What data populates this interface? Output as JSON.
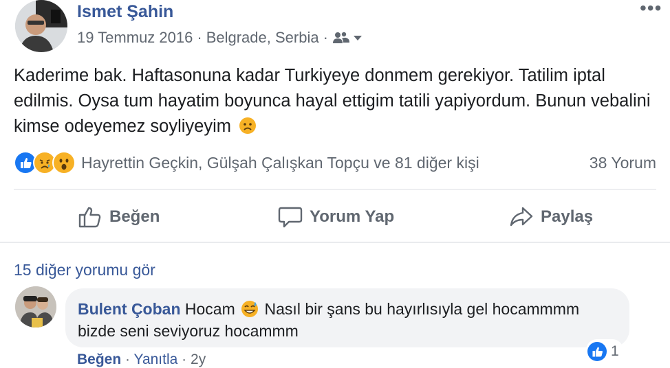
{
  "post": {
    "author": "Ismet Şahin",
    "date": "19 Temmuz 2016",
    "location": "Belgrade, Serbia",
    "meta_sep": "·",
    "text": "Kaderime bak. Haftasonuna kadar Turkiyeye donmem gerekiyor. Tatilim iptal edilmis. Oysa tum hayatim boyunca hayal ettigim tatili yapiyordum. Bunun vebalini kimse odeyemez soyliyeyim",
    "more_label": "•••"
  },
  "reactions": {
    "types": [
      "like",
      "sad",
      "wow"
    ],
    "names": "Hayrettin Geçkin, Gülşah Çalışkan Topçu ve 81 diğer kişi",
    "comments_count": "38 Yorum"
  },
  "actions": {
    "like": "Beğen",
    "comment": "Yorum Yap",
    "share": "Paylaş"
  },
  "comments": {
    "more_label": "15 diğer yorumu gör",
    "first": {
      "author": "Bulent Çoban",
      "text_before": "Hocam",
      "text_after": "Nasıl bir şans bu hayırlısıyla gel hocammmm bizde seni seviyoruz hocammm",
      "reaction_count": "1",
      "like_label": "Beğen",
      "reply_label": "Yanıtla",
      "time": "2y",
      "sep": "·"
    }
  },
  "colors": {
    "link": "#385898",
    "muted": "#606770",
    "like_blue": "#1877f2",
    "emoji_yellow": "#f7b125"
  }
}
